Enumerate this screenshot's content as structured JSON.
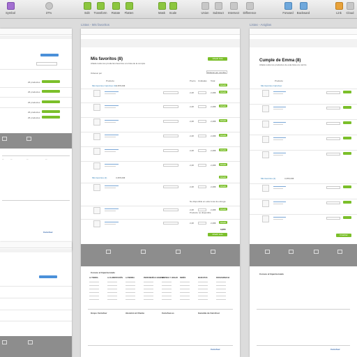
{
  "toolbar": {
    "symbol": "Symbol",
    "zoom": "37%",
    "items": [
      "Edit",
      "Transform",
      "Rotate",
      "Flatten",
      "Mask",
      "Scale",
      "Union",
      "Subtract",
      "Intersect",
      "Difference",
      "Forward",
      "Backward",
      "Link",
      "Cloud"
    ]
  },
  "artboards": {
    "left_label": "",
    "center_label": "Listas - Mis favoritos",
    "right_label": "Listas - Aniglias"
  },
  "center": {
    "title": "Mis favoritos (8)",
    "subtitle": "Añade todos tus productos favoritos a tu lista de la compra",
    "add_button": "Añadir lista",
    "sort_label": "Ordenar por",
    "sort_value": "Ordenar por nombre",
    "col_product": "Producto",
    "col_price": "Precio",
    "col_units": "Unidades",
    "col_total": "Total",
    "group1": "Mis favoritos Carrefour (6)",
    "group1_total": "3,355,00€",
    "group2": "Mis favoritos (2)",
    "group2_total": "3,355,00€",
    "item_price": "2,28",
    "item_total": "2,28€",
    "add": "Añadir",
    "no_disponible": "No disponible en esta zona de entrega",
    "producto_no_disp": "Producto no disponible",
    "total": "3,355",
    "finalize": "Añadir todo",
    "explore": "Conoce el hipermercado",
    "footer_cols": [
      "LA TIENDA",
      "LA ALIMENTACIÓN",
      "LA BEBIDA",
      "PERFUMERÍA E HIGIENE",
      "LIMPIEZA Y HOGAR",
      "BEBÉS",
      "MASCOTAS",
      "PARAFARMACIA"
    ],
    "footer_bottom": [
      "Grupo Carrefour",
      "Atención al Cliente",
      "Carrefour.es",
      "Garantía de Carrefour"
    ],
    "brand": "Carrefour"
  },
  "right": {
    "title": "Cumple de Emma (8)",
    "subtitle": "Añade todos los productos de esta lista a tu carrito",
    "col_product": "Producto",
    "group1": "Mis favoritos Carrefour",
    "group2": "Mis favoritos (2)",
    "group_total": "3,355,00€",
    "finalize": "Finalizar",
    "explore": "Conoce el hipermercado",
    "brand": "Carrefour"
  },
  "left": {
    "products_label": "26 productos",
    "add_label": "Añadir a la lista",
    "brand": "Carrefour"
  },
  "colors": {
    "green": "#7bbf2a",
    "blue": "#4a90d9",
    "gray": "#8d8d8d"
  }
}
